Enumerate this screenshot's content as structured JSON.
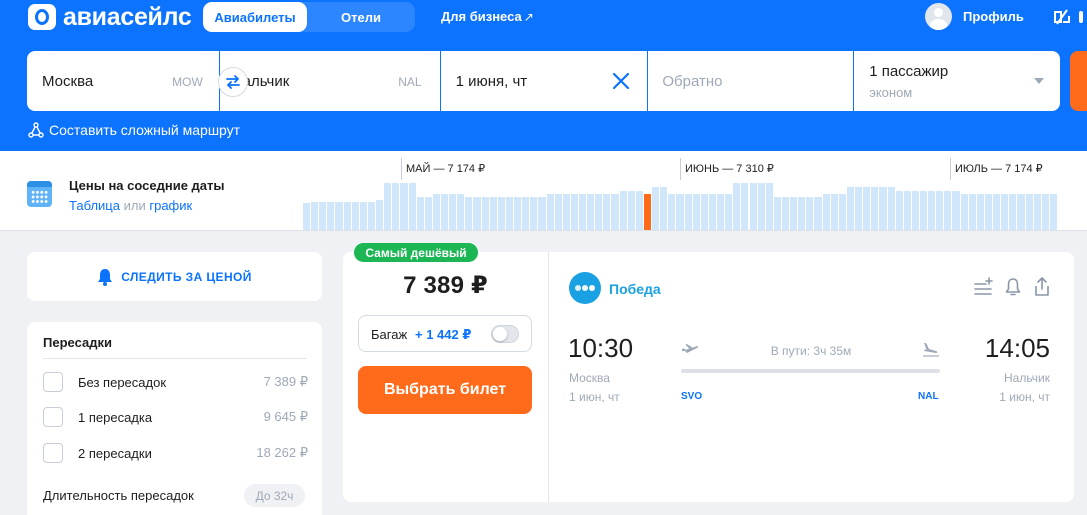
{
  "header": {
    "logo_text": "авиасейлс",
    "tabs": [
      {
        "label": "Авиабилеты",
        "active": true
      },
      {
        "label": "Отели",
        "active": false
      }
    ],
    "business_link": "Для бизнеса",
    "business_arrow": "↗",
    "profile_label": "Профиль"
  },
  "search": {
    "origin_city": "Москва",
    "origin_code": "MOW",
    "destination_city": "Нальчик",
    "destination_code": "NAL",
    "depart_date": "1 июня, чт",
    "return_placeholder": "Обратно",
    "passengers": "1 пассажир",
    "cabin_class": "эконом",
    "complex_route_label": "Составить сложный маршрут"
  },
  "price_calendar": {
    "title": "Цены на соседние даты",
    "link_table": "Таблица",
    "link_or": "или",
    "link_chart": "график",
    "months": [
      {
        "label": "МАЙ — 7 174 ₽"
      },
      {
        "label": "ИЮНЬ — 7 310 ₽"
      },
      {
        "label": "ИЮЛЬ — 7 174 ₽"
      }
    ],
    "selected_index": 42,
    "bar_levels": [
      0.55,
      0.58,
      0.58,
      0.58,
      0.58,
      0.58,
      0.58,
      0.58,
      0.58,
      0.62,
      0.95,
      0.95,
      0.95,
      0.95,
      0.68,
      0.68,
      0.74,
      0.74,
      0.74,
      0.74,
      0.68,
      0.68,
      0.68,
      0.68,
      0.68,
      0.68,
      0.68,
      0.68,
      0.68,
      0.68,
      0.74,
      0.74,
      0.74,
      0.74,
      0.74,
      0.74,
      0.74,
      0.74,
      0.74,
      0.8,
      0.8,
      0.8,
      0.74,
      0.88,
      0.88,
      0.74,
      0.74,
      0.74,
      0.74,
      0.74,
      0.74,
      0.74,
      0.74,
      0.95,
      0.95,
      0.95,
      0.95,
      0.95,
      0.68,
      0.68,
      0.68,
      0.68,
      0.68,
      0.68,
      0.74,
      0.74,
      0.74,
      0.88,
      0.88,
      0.88,
      0.88,
      0.88,
      0.88,
      0.8,
      0.8,
      0.8,
      0.8,
      0.8,
      0.8,
      0.8,
      0.8,
      0.74,
      0.74,
      0.74,
      0.74,
      0.74,
      0.74,
      0.74,
      0.74,
      0.74,
      0.74,
      0.74,
      0.74
    ]
  },
  "filters": {
    "follow_price_label": "СЛЕДИТЬ ЗА ЦЕНОЙ",
    "transfers_title": "Пересадки",
    "options": [
      {
        "label": "Без пересадок",
        "price": "7 389 ₽"
      },
      {
        "label": "1 пересадка",
        "price": "9 645 ₽"
      },
      {
        "label": "2 пересадки",
        "price": "18 262 ₽"
      }
    ],
    "duration_label": "Длительность пересадок",
    "duration_value": "До 32ч"
  },
  "ticket": {
    "badge": "Самый дешёвый",
    "price": "7 389 ₽",
    "baggage_label": "Багаж",
    "baggage_add": "+ 1 442 ₽",
    "buy_button": "Выбрать билет",
    "airline": "Победа",
    "airline_color": "#1aa1e3",
    "depart_time": "10:30",
    "depart_city": "Москва",
    "depart_date": "1 июн, чт",
    "arrive_time": "14:05",
    "arrive_city": "Нальчик",
    "arrive_date": "1 июн, чт",
    "duration": "В пути: 3ч 35м",
    "depart_airport": "SVO",
    "arrive_airport": "NAL"
  },
  "colors": {
    "brand_blue": "#0c73fe",
    "accent_orange": "#ff6b1b",
    "badge_green": "#1cb655",
    "bar_blue": "#cfe6fb"
  },
  "icons": [
    "swap-icon",
    "clear-icon",
    "route-icon",
    "calendar-icon",
    "bell-icon",
    "filter-icon",
    "subscribe-icon",
    "share-icon",
    "takeoff-icon",
    "landing-icon"
  ]
}
